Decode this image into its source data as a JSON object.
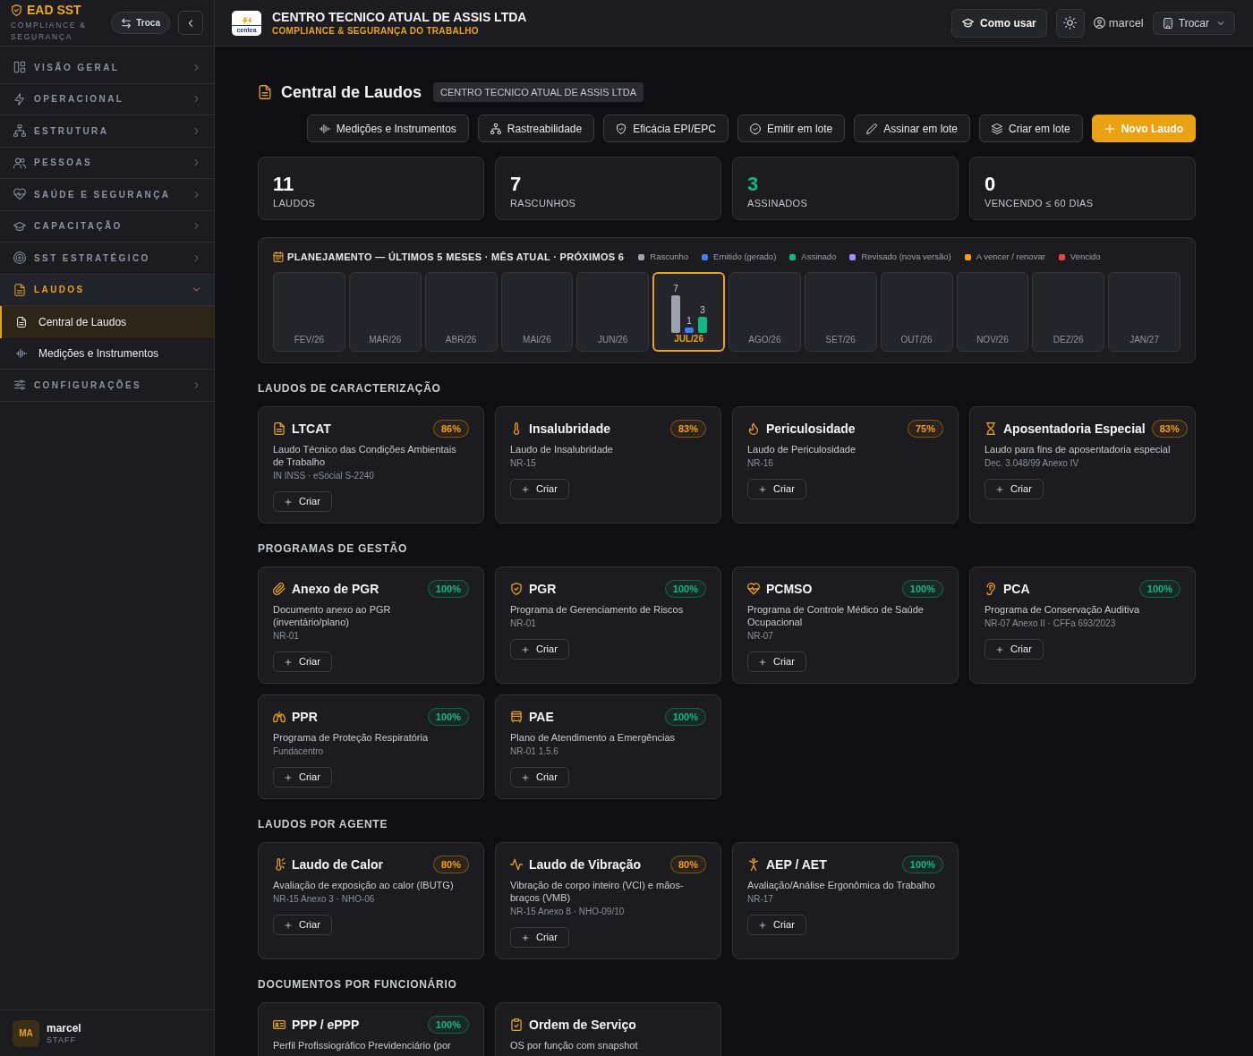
{
  "sidebar": {
    "brand": {
      "title": "EAD SST",
      "subtitle": "COMPLIANCE & SEGURANÇA"
    },
    "switch_button": "Troca",
    "nav": [
      {
        "label": "VISÃO GERAL",
        "kind": "grid",
        "expanded": false
      },
      {
        "label": "OPERACIONAL",
        "kind": "bolt",
        "expanded": false
      },
      {
        "label": "ESTRUTURA",
        "kind": "hierarchy",
        "expanded": false
      },
      {
        "label": "PESSOAS",
        "kind": "users",
        "expanded": false
      },
      {
        "label": "SAÚDE E SEGURANÇA",
        "kind": "heartpulse",
        "expanded": false
      },
      {
        "label": "CAPACITAÇÃO",
        "kind": "cap",
        "expanded": false
      },
      {
        "label": "SST ESTRATÉGICO",
        "kind": "target",
        "expanded": false
      },
      {
        "label": "LAUDOS",
        "kind": "report",
        "expanded": true,
        "children": [
          {
            "label": "Central de Laudos",
            "kind": "report",
            "selected": true
          },
          {
            "label": "Medições e Instrumentos",
            "kind": "wave",
            "selected": false
          }
        ]
      },
      {
        "label": "CONFIGURAÇÕES",
        "kind": "sliders",
        "expanded": false
      }
    ],
    "user": {
      "initials": "MA",
      "name": "marcel",
      "role": "STAFF"
    }
  },
  "header": {
    "logo_text": "centea",
    "company": "CENTRO TECNICO ATUAL DE ASSIS LTDA",
    "subtitle": "COMPLIANCE & SEGURANÇA DO TRABALHO",
    "help_button": "Como usar",
    "user": "marcel",
    "switch_button": "Trocar"
  },
  "page": {
    "title": "Central de Laudos",
    "company_badge": "CENTRO TECNICO ATUAL DE ASSIS LTDA",
    "actions": [
      {
        "label": "Medições e Instrumentos",
        "kind": "wave",
        "primary": false
      },
      {
        "label": "Rastreabilidade",
        "kind": "hierarchy",
        "primary": false
      },
      {
        "label": "Eficácia EPI/EPC",
        "kind": "shield",
        "primary": false
      },
      {
        "label": "Emitir em lote",
        "kind": "check",
        "primary": false
      },
      {
        "label": "Assinar em lote",
        "kind": "pen",
        "primary": false
      },
      {
        "label": "Criar em lote",
        "kind": "layers",
        "primary": false
      },
      {
        "label": "Novo Laudo",
        "kind": "plus",
        "primary": true
      }
    ]
  },
  "stats": [
    {
      "value": "11",
      "label": "LAUDOS",
      "color": "#ffffff"
    },
    {
      "value": "7",
      "label": "RASCUNHOS",
      "color": "#ffffff"
    },
    {
      "value": "3",
      "label": "ASSINADOS",
      "color": "#10b981"
    },
    {
      "value": "0",
      "label": "VENCENDO ≤ 60 DIAS",
      "color": "#ffffff"
    }
  ],
  "planning": {
    "title": "PLANEJAMENTO — ÚLTIMOS 5 MESES · MÊS ATUAL · PRÓXIMOS 6",
    "tiles": [
      {
        "selected": false
      },
      {
        "selected": false
      },
      {
        "selected": false
      },
      {
        "selected": false
      },
      {
        "selected": false
      },
      {
        "selected": true
      },
      {
        "selected": false
      },
      {
        "selected": false
      },
      {
        "selected": false
      },
      {
        "selected": false
      },
      {
        "selected": false
      },
      {
        "selected": false
      }
    ],
    "chart_data": {
      "type": "bar",
      "categories": [
        "FEV/26",
        "MAR/26",
        "ABR/26",
        "MAI/26",
        "JUN/26",
        "JUL/26",
        "AGO/26",
        "SET/26",
        "OUT/26",
        "NOV/26",
        "DEZ/26",
        "JAN/27"
      ],
      "series": [
        {
          "name": "Rascunho",
          "color": "#9ca3af",
          "values": [
            null,
            null,
            null,
            null,
            null,
            7,
            null,
            null,
            null,
            null,
            null,
            null
          ]
        },
        {
          "name": "Emitido (gerado)",
          "color": "#3b82f6",
          "values": [
            null,
            null,
            null,
            null,
            null,
            1,
            null,
            null,
            null,
            null,
            null,
            null
          ]
        },
        {
          "name": "Assinado",
          "color": "#10b981",
          "values": [
            null,
            null,
            null,
            null,
            null,
            3,
            null,
            null,
            null,
            null,
            null,
            null
          ]
        },
        {
          "name": "Revisado (nova versão)",
          "color": "#a78bfa",
          "values": [
            null,
            null,
            null,
            null,
            null,
            null,
            null,
            null,
            null,
            null,
            null,
            null
          ]
        },
        {
          "name": "A vencer / renovar",
          "color": "#f59e0b",
          "values": [
            null,
            null,
            null,
            null,
            null,
            null,
            null,
            null,
            null,
            null,
            null,
            null
          ]
        },
        {
          "name": "Vencido",
          "color": "#ef4444",
          "values": [
            null,
            null,
            null,
            null,
            null,
            null,
            null,
            null,
            null,
            null,
            null,
            null
          ]
        }
      ],
      "data_labels": true
    }
  },
  "sections": [
    {
      "title": "LAUDOS DE CARACTERIZAÇÃO",
      "cards": [
        {
          "kind": "document",
          "title": "LTCAT",
          "badge": "86%",
          "color": "#f59e0b",
          "description": "Laudo Técnico das Condições Ambientais de Trabalho",
          "reference": "IN INSS · eSocial S-2240",
          "action": "Criar"
        },
        {
          "kind": "thermometer",
          "title": "Insalubridade",
          "badge": "83%",
          "color": "#f59e0b",
          "description": "Laudo de Insalubridade",
          "reference": "NR-15",
          "action": "Criar"
        },
        {
          "kind": "flame",
          "title": "Periculosidade",
          "badge": "75%",
          "color": "#f59e0b",
          "description": "Laudo de Periculosidade",
          "reference": "NR-16",
          "action": "Criar"
        },
        {
          "kind": "hourglass",
          "title": "Aposentadoria Especial",
          "badge": "83%",
          "color": "#f59e0b",
          "description": "Laudo para fins de aposentadoria especial",
          "reference": "Dec. 3.048/99 Anexo IV",
          "action": "Criar"
        }
      ]
    },
    {
      "title": "PROGRAMAS DE GESTÃO",
      "cards": [
        {
          "kind": "paperclip",
          "title": "Anexo de PGR",
          "badge": "100%",
          "color": "#10b981",
          "description": "Documento anexo ao PGR (inventário/plano)",
          "reference": "NR-01",
          "action": "Criar"
        },
        {
          "kind": "shield",
          "title": "PGR",
          "badge": "100%",
          "color": "#10b981",
          "description": "Programa de Gerenciamento de Riscos",
          "reference": "NR-01",
          "action": "Criar"
        },
        {
          "kind": "heartpulse",
          "title": "PCMSO",
          "badge": "100%",
          "color": "#10b981",
          "description": "Programa de Controle Médico de Saúde Ocupacional",
          "reference": "NR-07",
          "action": "Criar"
        },
        {
          "kind": "ear",
          "title": "PCA",
          "badge": "100%",
          "color": "#10b981",
          "description": "Programa de Conservação Auditiva",
          "reference": "NR-07 Anexo II · CFFa 693/2023",
          "action": "Criar"
        },
        {
          "kind": "lungs",
          "title": "PPR",
          "badge": "100%",
          "color": "#10b981",
          "description": "Programa de Proteção Respiratória",
          "reference": "Fundacentro",
          "action": "Criar"
        },
        {
          "kind": "bus",
          "title": "PAE",
          "badge": "100%",
          "color": "#10b981",
          "description": "Plano de Atendimento a Emergências",
          "reference": "NR-01 1.5.6",
          "action": "Criar"
        }
      ]
    },
    {
      "title": "LAUDOS POR AGENTE",
      "cards": [
        {
          "kind": "thermosun",
          "title": "Laudo de Calor",
          "badge": "80%",
          "color": "#f59e0b",
          "description": "Avaliação de exposição ao calor (IBUTG)",
          "reference": "NR-15 Anexo 3 · NHO-06",
          "action": "Criar"
        },
        {
          "kind": "pulse",
          "title": "Laudo de Vibração",
          "badge": "80%",
          "color": "#f59e0b",
          "description": "Vibração de corpo inteiro (VCI) e mãos-braços (VMB)",
          "reference": "NR-15 Anexo 8 · NHO-09/10",
          "action": "Criar"
        },
        {
          "kind": "person",
          "title": "AEP / AET",
          "badge": "100%",
          "color": "#10b981",
          "description": "Avaliação/Análise Ergonômica do Trabalho",
          "reference": "NR-17",
          "action": "Criar"
        }
      ]
    },
    {
      "title": "DOCUMENTOS POR FUNCIONÁRIO",
      "cards": [
        {
          "kind": "idcard",
          "title": "PPP / ePPP",
          "badge": "100%",
          "color": "#10b981",
          "description": "Perfil Profissiográfico Previdenciário (por"
        },
        {
          "kind": "clipboard",
          "title": "Ordem de Serviço",
          "description": "OS por função com snapshot"
        }
      ]
    }
  ]
}
